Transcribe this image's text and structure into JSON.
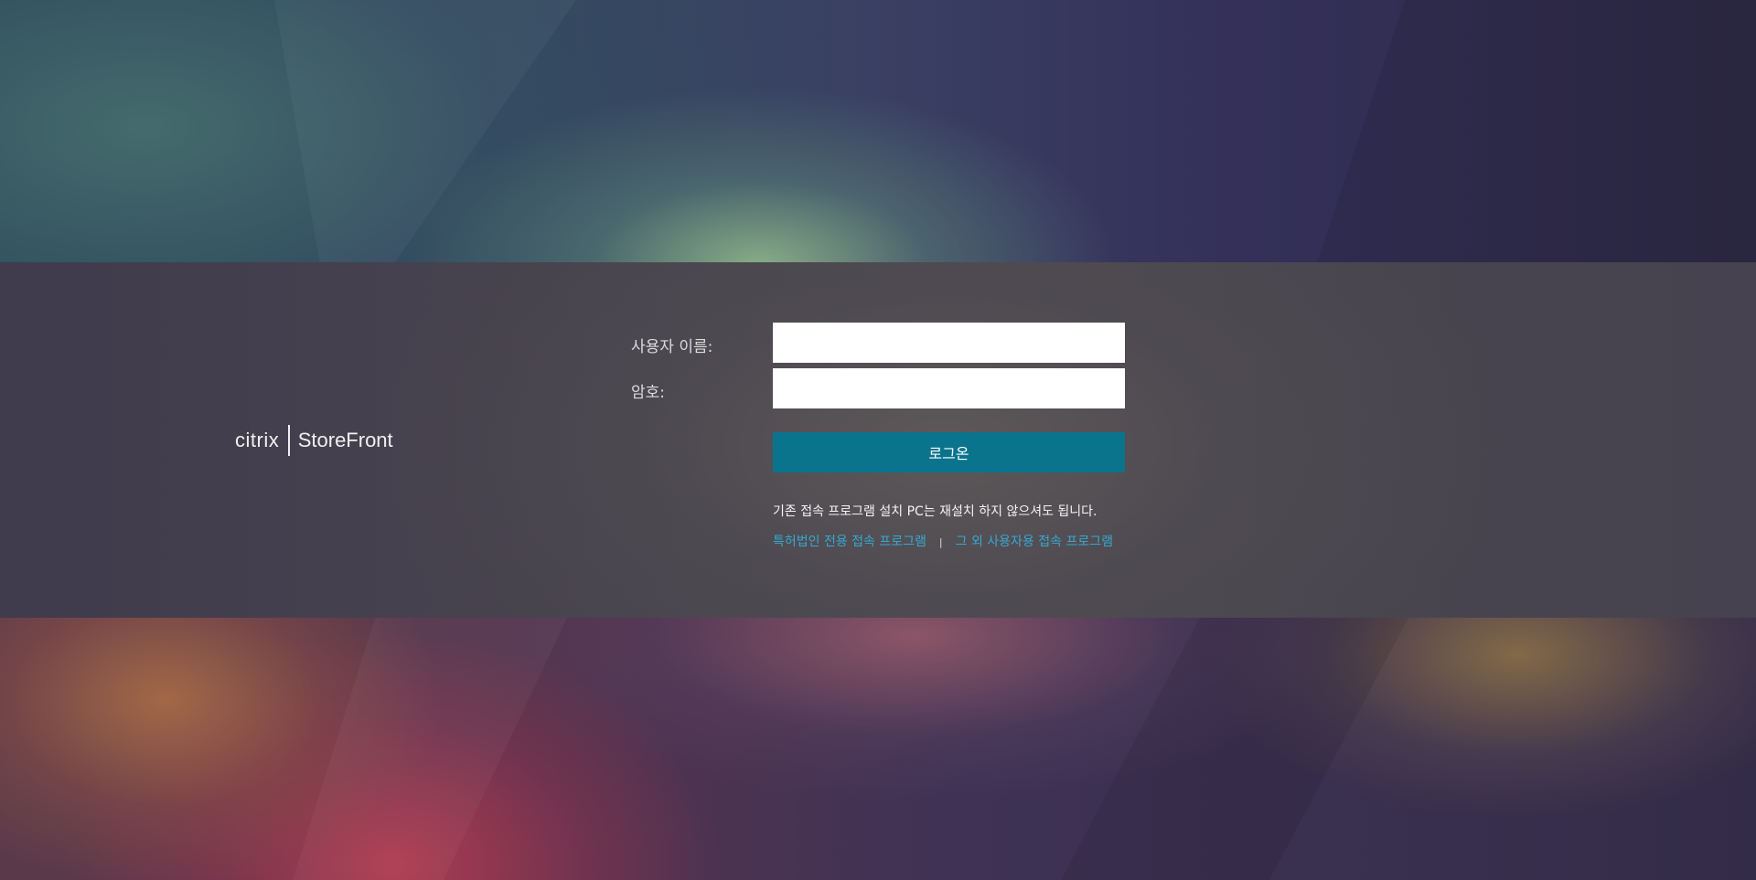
{
  "brand": {
    "logo_text": "citrix",
    "product_name": "StoreFront"
  },
  "login_form": {
    "username_label": "사용자 이름:",
    "password_label": "암호:",
    "username_value": "",
    "password_value": "",
    "login_button_label": "로그온"
  },
  "notice": {
    "text": "기존 접속 프로그램 설치 PC는 재설치 하지 않으셔도 됩니다."
  },
  "download_links": [
    {
      "label": "특허법인 전용 접속 프로그램"
    },
    {
      "label": "그 외 사용자용 접속 프로그램"
    }
  ],
  "link_separator": "|",
  "colors": {
    "button": "#0a748d",
    "link": "#37a8d3",
    "band": "#48444e"
  }
}
